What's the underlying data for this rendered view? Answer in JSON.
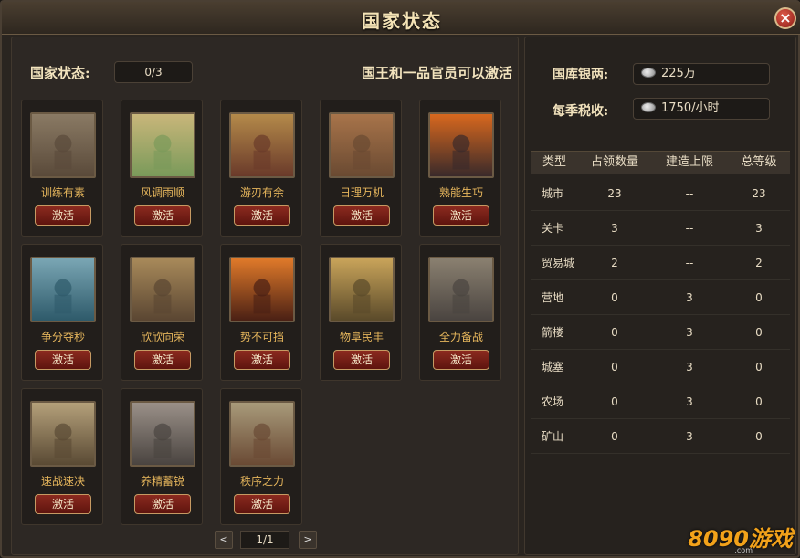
{
  "window": {
    "title": "国家状态",
    "close_icon": "close-icon"
  },
  "status": {
    "label": "国家状态:",
    "value": "0/3",
    "notice": "国王和一品官员可以激活"
  },
  "cards": [
    {
      "name": "训练有素",
      "button": "激活"
    },
    {
      "name": "风调雨顺",
      "button": "激活"
    },
    {
      "name": "游刃有余",
      "button": "激活"
    },
    {
      "name": "日理万机",
      "button": "激活"
    },
    {
      "name": "熟能生巧",
      "button": "激活"
    },
    {
      "name": "争分夺秒",
      "button": "激活"
    },
    {
      "name": "欣欣向荣",
      "button": "激活"
    },
    {
      "name": "势不可挡",
      "button": "激活"
    },
    {
      "name": "物阜民丰",
      "button": "激活"
    },
    {
      "name": "全力备战",
      "button": "激活"
    },
    {
      "name": "速战速决",
      "button": "激活"
    },
    {
      "name": "养精蓄锐",
      "button": "激活"
    },
    {
      "name": "秩序之力",
      "button": "激活"
    }
  ],
  "pager": {
    "prev": "<",
    "page": "1/1",
    "next": ">"
  },
  "treasury": {
    "label": "国库银两:",
    "value": "225万"
  },
  "tax": {
    "label": "每季税收:",
    "value": "1750/小时"
  },
  "table": {
    "headers": [
      "类型",
      "占领数量",
      "建造上限",
      "总等级"
    ],
    "rows": [
      [
        "城市",
        "23",
        "--",
        "23"
      ],
      [
        "关卡",
        "3",
        "--",
        "3"
      ],
      [
        "贸易城",
        "2",
        "--",
        "2"
      ],
      [
        "营地",
        "0",
        "3",
        "0"
      ],
      [
        "箭楼",
        "0",
        "3",
        "0"
      ],
      [
        "城塞",
        "0",
        "3",
        "0"
      ],
      [
        "农场",
        "0",
        "3",
        "0"
      ],
      [
        "矿山",
        "0",
        "3",
        "0"
      ]
    ]
  },
  "watermark": {
    "brand": "8090游戏",
    "domain": ".com"
  }
}
